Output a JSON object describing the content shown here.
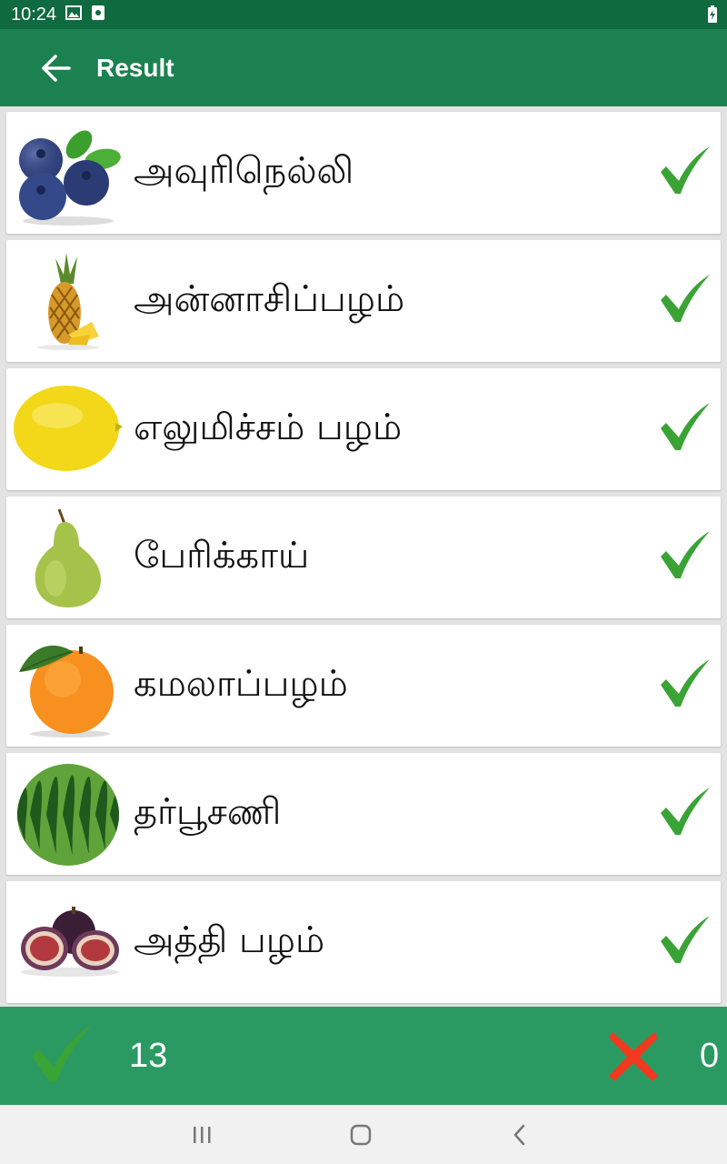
{
  "status_bar": {
    "time": "10:24",
    "icons": [
      "image-icon",
      "sim-icon",
      "battery-charging-icon"
    ]
  },
  "app_bar": {
    "title": "Result",
    "back_icon": "arrow-back-icon"
  },
  "results": [
    {
      "name": "அவுரிநெல்லி",
      "image": "blueberries",
      "status": "correct"
    },
    {
      "name": "அன்னாசிப்பழம்",
      "image": "pineapple",
      "status": "correct"
    },
    {
      "name": "எலுமிச்சம் பழம்",
      "image": "lemon",
      "status": "correct"
    },
    {
      "name": "பேரிக்காய்",
      "image": "pear",
      "status": "correct"
    },
    {
      "name": "கமலாப்பழம்",
      "image": "orange",
      "status": "correct"
    },
    {
      "name": "தர்பூசணி",
      "image": "watermelon",
      "status": "correct"
    },
    {
      "name": "அத்தி பழம்",
      "image": "fig",
      "status": "correct"
    }
  ],
  "score": {
    "correct": "13",
    "wrong": "0"
  },
  "colors": {
    "status_bar": "#0f6a3f",
    "app_bar": "#1b8150",
    "score_bar": "#2b9a62",
    "check": "#3aa335",
    "cross": "#f13a1f"
  },
  "nav_bar": {
    "buttons": [
      "recents-icon",
      "home-icon",
      "back-icon"
    ]
  }
}
